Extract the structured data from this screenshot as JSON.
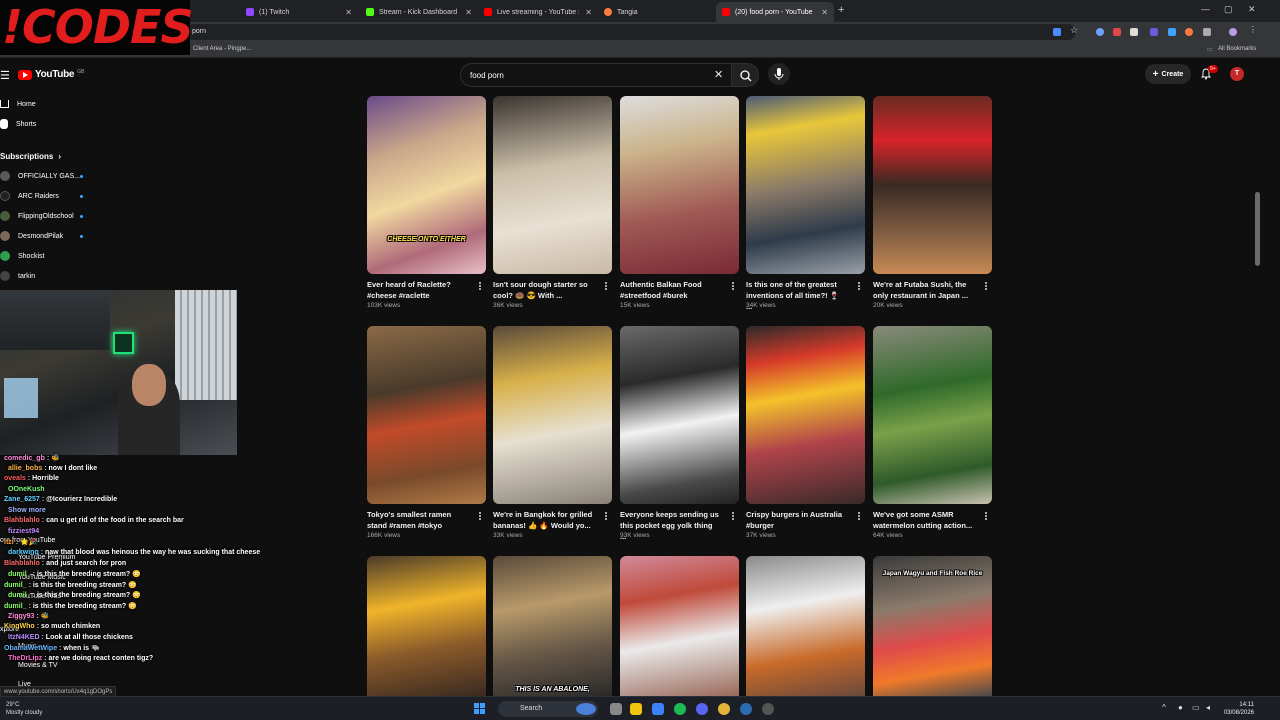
{
  "browser": {
    "tabs": [
      {
        "title": "(1) Twitch",
        "color": "#9146ff"
      },
      {
        "title": "Stream - Kick Dashboard",
        "color": "#53fc18"
      },
      {
        "title": "Live streaming - YouTube Studio",
        "color": "#ff0000"
      },
      {
        "title": "Tangia",
        "color": "#ff7a3d"
      },
      {
        "title": "(20) food porn - YouTube",
        "color": "#ff0000"
      }
    ],
    "address": "porn",
    "bookmark_left": "Client Area - Pingpe...",
    "bookmark_right": "All Bookmarks"
  },
  "overlay": {
    "logo_text": "!CODES",
    "logo_color": "#e11d1d"
  },
  "youtube": {
    "logo_word": "YouTube",
    "logo_country": "GB",
    "search_query": "food porn",
    "create_label": "Create",
    "notif_badge": "9+",
    "avatar_letter": "T"
  },
  "sidebar": {
    "home": "Home",
    "shorts": "Shorts",
    "subscriptions": "Subscriptions",
    "subs": [
      "OFFICIALLY GAS...",
      "ARC Raiders",
      "FlippingOldschool",
      "DesmondPilak",
      "Shockist",
      "tarkin"
    ],
    "overlap": [
      "ore from YouTube",
      "YouTube Premium",
      "YouTube Music",
      "YouTube Kids",
      "xplore",
      "Music",
      "Movies & TV",
      "Live"
    ]
  },
  "chat": [
    {
      "user": "comedic_gb",
      "color": "#ff8ad8",
      "msg": "🐝"
    },
    {
      "user": "allie_bobs",
      "color": "#ffb347",
      "msg": "now I dont like"
    },
    {
      "user": "oveals",
      "color": "#ff5b5b",
      "msg": "Horrible"
    },
    {
      "user": "OOneKush",
      "color": "#7cff7c",
      "msg": ""
    },
    {
      "user": "Zane_6257",
      "color": "#63d4ff",
      "msg": "@Icourierz Incredible"
    },
    {
      "user": "Show more",
      "color": "#9fb4ff",
      "msg": ""
    },
    {
      "user": "Blahblahlo",
      "color": "#ff6b6b",
      "msg": "can u get rid of the food in the search bar"
    },
    {
      "user": "fizziest94",
      "color": "#c58bff",
      "msg": ""
    },
    {
      "user": "Itzi",
      "color": "#ff9f40",
      "msg": "🌟🎉"
    },
    {
      "user": "darkwing",
      "color": "#5fd3ff",
      "msg": "naw that blood was heinous the way he was sucking that cheese"
    },
    {
      "user": "Blahblahlo",
      "color": "#ff6b6b",
      "msg": "and just search for pron"
    },
    {
      "user": "dumil_",
      "color": "#8dff6b",
      "msg": "is this the breeding stream? 😳"
    },
    {
      "user": "dumil_",
      "color": "#8dff6b",
      "msg": "is this the breeding stream? 😳"
    },
    {
      "user": "dumil_",
      "color": "#8dff6b",
      "msg": "is this the breeding stream? 😳"
    },
    {
      "user": "dumil_",
      "color": "#8dff6b",
      "msg": "is this the breeding stream? 😳"
    },
    {
      "user": "Ziggy93",
      "color": "#ff8ad8",
      "msg": "🐝"
    },
    {
      "user": "KingWho",
      "color": "#ffd24d",
      "msg": "so much chimken"
    },
    {
      "user": "ItzN4KED",
      "color": "#b98bff",
      "msg": "Look at all those chickens"
    },
    {
      "user": "ObamaWetWipe",
      "color": "#6bb8ff",
      "msg": "when is 🐃"
    },
    {
      "user": "TheDrLipz",
      "color": "#ff6bd0",
      "msg": "are we doing react conten tigz?"
    }
  ],
  "videos": [
    {
      "title": "Ever heard of Raclette? #cheese #raclette",
      "views": "103K views",
      "caption": "CHEESE ONTO EITHER"
    },
    {
      "title": "Isn't sour dough starter so cool? 🍩 😎 With ...",
      "views": "36K views",
      "caption": ""
    },
    {
      "title": "Authentic Balkan Food #streetfood #burek",
      "views": "15K views",
      "caption": ""
    },
    {
      "title": "Is this one of the greatest inventions of all time?! 🍷 ...",
      "views": "34K views",
      "caption": ""
    },
    {
      "title": "We're at Futaba Sushi, the only restaurant in Japan ...",
      "views": "20K views",
      "caption": ""
    },
    {
      "title": "Tokyo's smallest ramen stand #ramen #tokyo",
      "views": "166K views",
      "caption": ""
    },
    {
      "title": "We're in Bangkok for grilled bananas! 👍 🔥 Would yo...",
      "views": "33K views",
      "caption": ""
    },
    {
      "title": "Everyone keeps sending us this pocket egg yolk thing ...",
      "views": "93K views",
      "caption": ""
    },
    {
      "title": "Crispy burgers in Australia #burger",
      "views": "37K views",
      "caption": ""
    },
    {
      "title": "We've got some ASMR watermelon cutting action...",
      "views": "64K views",
      "caption": ""
    },
    {
      "title": "",
      "views": "",
      "caption": ""
    },
    {
      "title": "",
      "views": "",
      "caption": "THIS IS AN ABALONE,"
    },
    {
      "title": "",
      "views": "",
      "caption": ""
    },
    {
      "title": "",
      "views": "",
      "caption": ""
    },
    {
      "title": "",
      "views": "",
      "caption": "Japan Wagyu and Fish Roe Rice"
    }
  ],
  "status_url": "www.youtube.com/shorts/Ux4q1gDOgPs",
  "taskbar": {
    "weather_temp": "29°C",
    "weather_desc": "Mostly cloudy",
    "search": "Search",
    "time": "14:11",
    "date": "03/08/2026"
  }
}
